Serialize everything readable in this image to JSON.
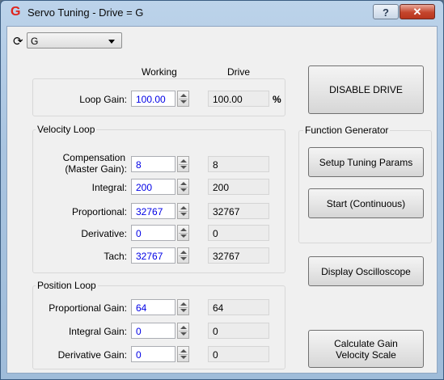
{
  "window": {
    "title": "Servo Tuning - Drive = G",
    "help_glyph": "?",
    "close_glyph": "✕",
    "app_icon_glyph": "G"
  },
  "toolbar": {
    "refresh_glyph": "⟳",
    "drive_select": "G"
  },
  "headers": {
    "working": "Working",
    "drive": "Drive"
  },
  "loop_gain": {
    "label": "Loop Gain:",
    "working": "100.00",
    "drive": "100.00",
    "unit": "%"
  },
  "velocity_loop": {
    "title": "Velocity Loop",
    "compensation_label_1": "Compensation",
    "compensation_label_2": "(Master Gain):",
    "compensation_working": "8",
    "compensation_drive": "8",
    "integral_label": "Integral:",
    "integral_working": "200",
    "integral_drive": "200",
    "proportional_label": "Proportional:",
    "proportional_working": "32767",
    "proportional_drive": "32767",
    "derivative_label": "Derivative:",
    "derivative_working": "0",
    "derivative_drive": "0",
    "tach_label": "Tach:",
    "tach_working": "32767",
    "tach_drive": "32767"
  },
  "position_loop": {
    "title": "Position Loop",
    "proportional_gain_label": "Proportional Gain:",
    "proportional_gain_working": "64",
    "proportional_gain_drive": "64",
    "integral_gain_label": "Integral Gain:",
    "integral_gain_working": "0",
    "integral_gain_drive": "0",
    "derivative_gain_label": "Derivative Gain:",
    "derivative_gain_working": "0",
    "derivative_gain_drive": "0"
  },
  "function_generator": {
    "title": "Function Generator"
  },
  "buttons": {
    "disable_drive": "DISABLE DRIVE",
    "setup_tuning": "Setup Tuning Params",
    "start_continuous": "Start (Continuous)",
    "display_oscilloscope": "Display Oscilloscope",
    "calc_gain_1": "Calculate Gain",
    "calc_gain_2": "Velocity Scale"
  }
}
